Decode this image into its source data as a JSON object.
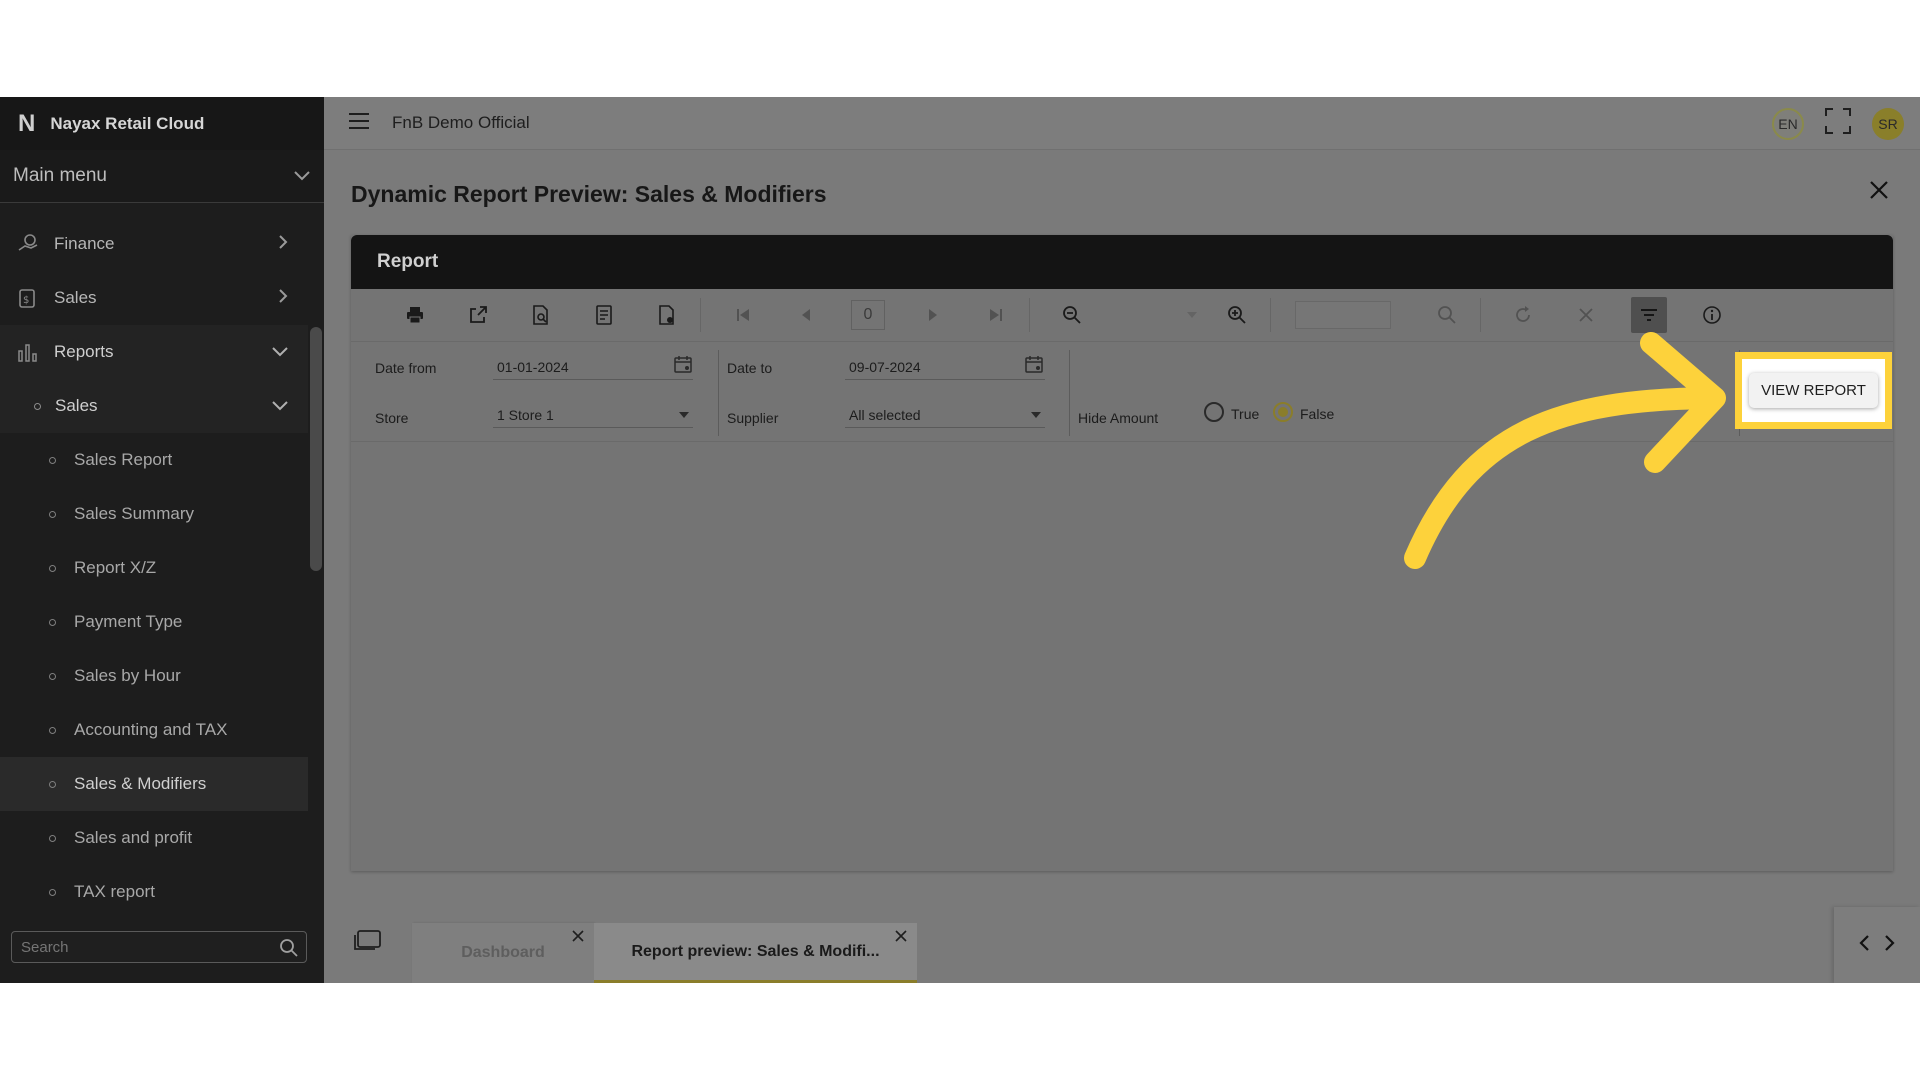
{
  "sidebar": {
    "brand": "Nayax Retail Cloud",
    "brand_logo": "N",
    "main_menu": "Main menu",
    "items": [
      {
        "label": "Finance",
        "icon": "finance-icon"
      },
      {
        "label": "Sales",
        "icon": "sales-icon"
      },
      {
        "label": "Reports",
        "icon": "reports-icon"
      }
    ],
    "reports_sub": {
      "label": "Sales"
    },
    "sales_leaves": [
      "Sales Report",
      "Sales Summary",
      "Report X/Z",
      "Payment Type",
      "Sales by Hour",
      "Accounting and TAX",
      "Sales & Modifiers",
      "Sales and profit",
      "TAX report"
    ],
    "search_placeholder": "Search"
  },
  "topbar": {
    "tenant": "FnB Demo Official",
    "lang": "EN",
    "user_initials": "SR"
  },
  "page": {
    "title": "Dynamic Report Preview: Sales & Modifiers"
  },
  "report": {
    "header": "Report",
    "page_number": "0",
    "params": {
      "date_from_label": "Date from",
      "date_from_value": "01-01-2024",
      "date_to_label": "Date to",
      "date_to_value": "09-07-2024",
      "store_label": "Store",
      "store_value": "1 Store 1",
      "supplier_label": "Supplier",
      "supplier_value": "All selected",
      "hide_amount_label": "Hide Amount",
      "true_label": "True",
      "false_label": "False",
      "selected": "False"
    },
    "view_button": "VIEW REPORT"
  },
  "tabs": [
    {
      "label": "Dashboard",
      "active": false
    },
    {
      "label": "Report preview: Sales & Modifi...",
      "active": true
    }
  ],
  "colors": {
    "highlight": "#fdd23b",
    "accent": "#8a7d2a"
  }
}
